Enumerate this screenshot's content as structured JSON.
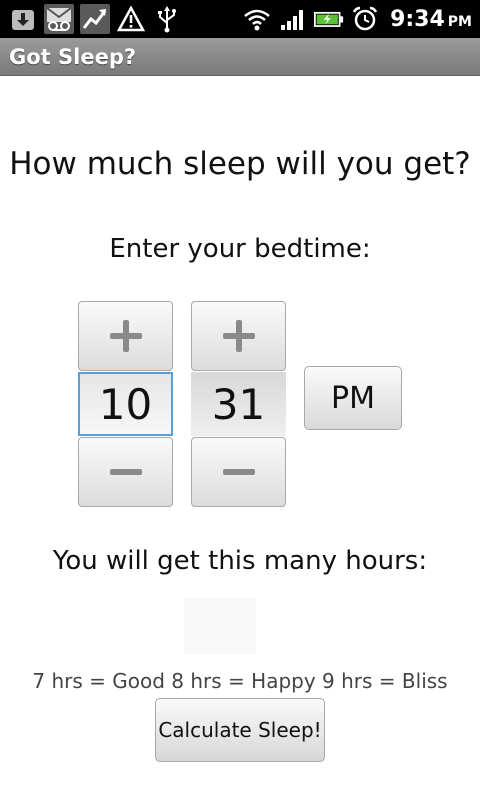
{
  "status_bar": {
    "time": "9:34",
    "ampm": "PM",
    "icons": [
      "download-icon",
      "voicemail-icon",
      "stocks-icon",
      "warning-icon",
      "usb-icon",
      "wifi-icon",
      "signal-icon",
      "battery-icon",
      "alarm-icon"
    ]
  },
  "app": {
    "title": "Got Sleep?"
  },
  "main": {
    "headline": "How much sleep will you get?",
    "bedtime_prompt": "Enter your bedtime:",
    "hour": "10",
    "minute": "31",
    "ampm_button": "PM",
    "result_label": "You will get this many hours:",
    "result_value": "",
    "legend": "7 hrs = Good 8 hrs = Happy 9 hrs = Bliss",
    "calculate_button": "Calculate Sleep!"
  },
  "colors": {
    "status_bar": "#000000",
    "title_bar": "#8a8a8a",
    "focus_outline": "#5aa0d8"
  }
}
